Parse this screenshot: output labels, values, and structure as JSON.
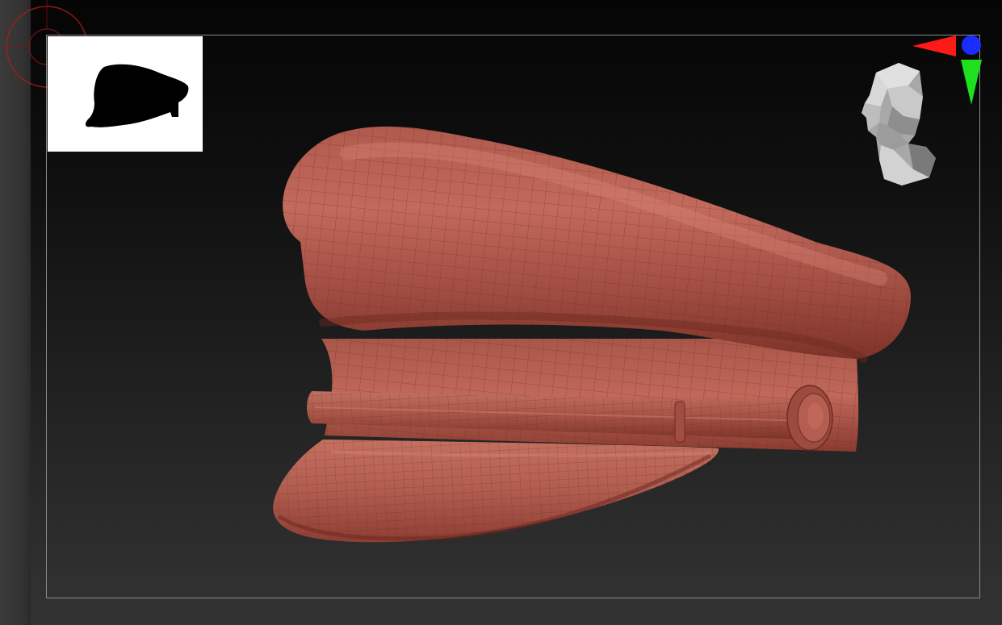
{
  "viewport": {
    "background_top": "#050505",
    "background_bottom": "#333333",
    "frame_color": "#8a8a8a"
  },
  "thumbnail": {
    "background": "#ffffff",
    "silhouette_color": "#000000"
  },
  "model": {
    "name_icon": "peaked-cap-model",
    "material_color": "#a84f44",
    "wireframe_color": "#6e2a22"
  },
  "gizmo": {
    "x_color": "#ff1a1a",
    "y_color": "#1ee01e",
    "z_color": "#1a2cff"
  },
  "navigator": {
    "icon": "head-navigation-icon"
  },
  "spotlight": {
    "color": "#cc1b1b",
    "icon": "spotlight-ring-icon"
  }
}
